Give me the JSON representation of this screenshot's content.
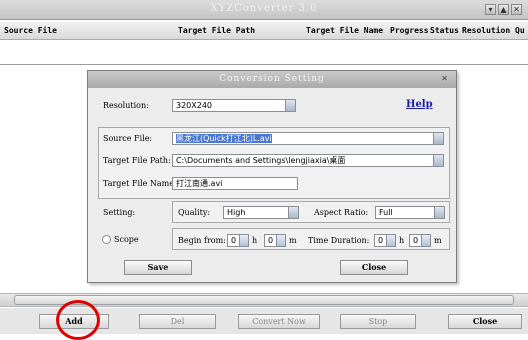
{
  "window": {
    "title": "XYZConverter 3.0",
    "controls": [
      "▾",
      "▲",
      "✕"
    ]
  },
  "columns": [
    "Source File",
    "Target File Path",
    "Target File Name",
    "Progress",
    "Status",
    "Resolution",
    "Qu"
  ],
  "toolbar": {
    "add": "Add",
    "del": "Del",
    "convert_now": "Convert Now",
    "stop": "Stop",
    "close": "Close"
  },
  "dialog": {
    "title": "Conversion Setting",
    "close_glyph": "✕",
    "resolution_label": "Resolution:",
    "resolution_value": "320X240",
    "help": "Help",
    "source_label": "Source File:",
    "source_value": "黑龙江(Quick打江北)L.avi",
    "target_path_label": "Target File Path:",
    "target_path_value": "C:\\Documents and Settings\\lengjiaxia\\桌面",
    "target_name_label": "Target File Name:",
    "target_name_value": "打江南通.avi",
    "setting_label": "Setting:",
    "quality_label": "Quality:",
    "quality_value": "High",
    "aspect_label": "Aspect Ratio:",
    "aspect_value": "Full",
    "scope_label": "Scope",
    "begin_label": "Begin from:",
    "h_unit": "h",
    "m_unit": "m",
    "duration_label": "Time Duration:",
    "begin_h": "0",
    "begin_m": "0",
    "dur_h": "0",
    "dur_m": "0",
    "save": "Save",
    "close": "Close"
  },
  "colors": {
    "highlight": "#4a78d0",
    "red_circle": "#e00000",
    "link": "#1a1aa8"
  }
}
